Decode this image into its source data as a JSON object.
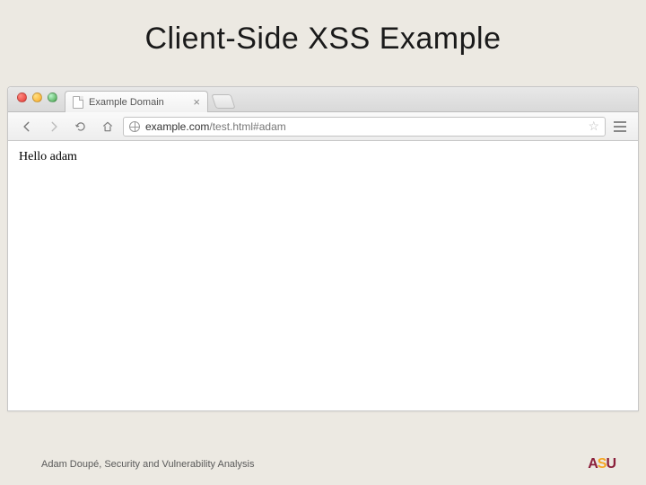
{
  "slide": {
    "title": "Client-Side XSS Example"
  },
  "browser": {
    "tab_title": "Example Domain",
    "url_domain": "example.com",
    "url_path": "/test.html#adam",
    "page_text": "Hello adam"
  },
  "footer": {
    "text": "Adam Doupé, Security and Vulnerability Analysis",
    "logo": {
      "a": "A",
      "s": "S",
      "u": "U"
    }
  }
}
